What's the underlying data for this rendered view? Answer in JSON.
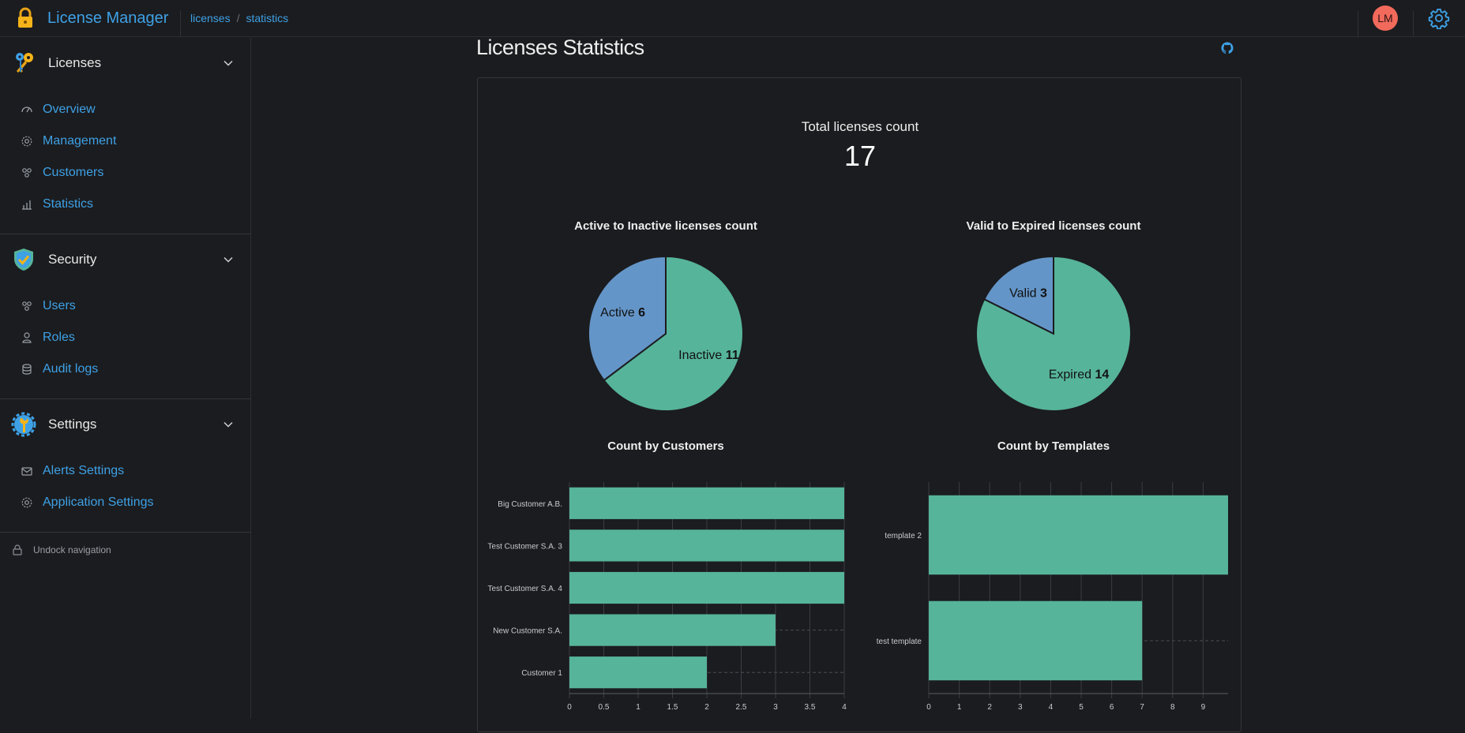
{
  "header": {
    "app_title": "License Manager",
    "breadcrumb": [
      "licenses",
      "statistics"
    ],
    "avatar_initials": "LM",
    "icons": {
      "logo": "lock-icon",
      "settings": "gear-icon"
    },
    "accent_color": "#3ea1e6",
    "avatar_color": "#f16a5b"
  },
  "sidebar": {
    "sections": [
      {
        "label": "Licenses",
        "icon": "key-icon",
        "items": [
          {
            "label": "Overview",
            "icon": "gauge-icon"
          },
          {
            "label": "Management",
            "icon": "gear-icon"
          },
          {
            "label": "Customers",
            "icon": "people-icon"
          },
          {
            "label": "Statistics",
            "icon": "chart-icon"
          }
        ]
      },
      {
        "label": "Security",
        "icon": "shield-icon",
        "items": [
          {
            "label": "Users",
            "icon": "people-icon"
          },
          {
            "label": "Roles",
            "icon": "person-icon"
          },
          {
            "label": "Audit logs",
            "icon": "database-icon"
          }
        ]
      },
      {
        "label": "Settings",
        "icon": "settings-wrench-icon",
        "items": [
          {
            "label": "Alerts Settings",
            "icon": "mail-icon"
          },
          {
            "label": "Application Settings",
            "icon": "gear-icon"
          }
        ]
      }
    ],
    "undock_label": "Undock navigation"
  },
  "main": {
    "title": "Licenses Statistics",
    "total_label": "Total licenses count",
    "total_value": "17"
  },
  "chart_data": [
    {
      "type": "pie",
      "title": "Active to Inactive licenses count",
      "labels": [
        "Active",
        "Inactive"
      ],
      "values": [
        6,
        11
      ],
      "colors": [
        "#6495c8",
        "#56b49a"
      ]
    },
    {
      "type": "pie",
      "title": "Valid to Expired licenses count",
      "labels": [
        "Valid",
        "Expired"
      ],
      "values": [
        3,
        14
      ],
      "colors": [
        "#6495c8",
        "#56b49a"
      ]
    },
    {
      "type": "bar",
      "orientation": "horizontal",
      "title": "Count by Customers",
      "categories": [
        "Big Customer A.B.",
        "Test Customer S.A. 3",
        "Test Customer S.A. 4",
        "New Customer S.A.",
        "Customer 1"
      ],
      "values": [
        4,
        4,
        4,
        3,
        2
      ],
      "xlim": [
        0,
        4
      ],
      "xticks": [
        "0",
        "0.5",
        "1",
        "1.5",
        "2",
        "2.5",
        "3",
        "3.5",
        "4"
      ],
      "color": "#56b49a"
    },
    {
      "type": "bar",
      "orientation": "horizontal",
      "title": "Count by Templates",
      "categories": [
        "template 2",
        "test template"
      ],
      "values": [
        10,
        7
      ],
      "xlim": [
        0,
        10
      ],
      "xticks": [
        "0",
        "1",
        "2",
        "3",
        "4",
        "5",
        "6",
        "7",
        "8",
        "9",
        "10"
      ],
      "color": "#56b49a"
    }
  ]
}
